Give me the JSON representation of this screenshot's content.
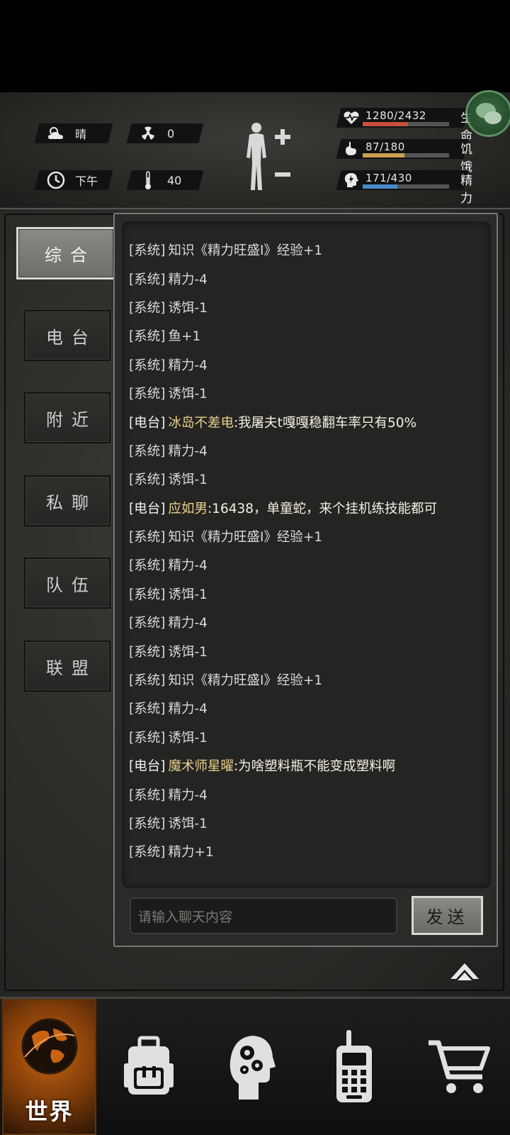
{
  "status": {
    "weather": {
      "icon": "cloud-sun-icon",
      "label": "晴"
    },
    "radiation": {
      "icon": "radiation-icon",
      "value": "0"
    },
    "time": {
      "icon": "clock-icon",
      "label": "下午"
    },
    "temperature": {
      "icon": "thermometer-icon",
      "value": "40"
    },
    "stats": [
      {
        "icon": "heart-pulse-icon",
        "text": "1280/2432",
        "label": "生命",
        "current": 1280,
        "max": 2432,
        "color": "#c9503a"
      },
      {
        "icon": "stomach-icon",
        "text": "87/180",
        "label": "饥饿",
        "current": 87,
        "max": 180,
        "color": "#c9a050"
      },
      {
        "icon": "head-lightning-icon",
        "text": "171/430",
        "label": "精力",
        "current": 171,
        "max": 430,
        "color": "#4a8ac9"
      }
    ]
  },
  "tabs": [
    {
      "label": "综合",
      "active": true
    },
    {
      "label": "电台",
      "active": false
    },
    {
      "label": "附近",
      "active": false
    },
    {
      "label": "私聊",
      "active": false
    },
    {
      "label": "队伍",
      "active": false
    },
    {
      "label": "联盟",
      "active": false
    }
  ],
  "chat": {
    "messages": [
      {
        "type": "system",
        "tag": "[系统]",
        "text": "知识《精力旺盛Ⅰ》经验+1"
      },
      {
        "type": "system",
        "tag": "[系统]",
        "text": "精力-4"
      },
      {
        "type": "system",
        "tag": "[系统]",
        "text": "诱饵-1"
      },
      {
        "type": "system",
        "tag": "[系统]",
        "text": "鱼+1"
      },
      {
        "type": "system",
        "tag": "[系统]",
        "text": "精力-4"
      },
      {
        "type": "system",
        "tag": "[系统]",
        "text": "诱饵-1"
      },
      {
        "type": "radio",
        "tag": "[电台]",
        "name": "冰岛不差电",
        "text": ":我屠夫t嘎嘎稳翻车率只有50%"
      },
      {
        "type": "system",
        "tag": "[系统]",
        "text": "精力-4"
      },
      {
        "type": "system",
        "tag": "[系统]",
        "text": "诱饵-1"
      },
      {
        "type": "radio",
        "tag": "[电台]",
        "name": "应如男",
        "text": ":16438，单童蛇，来个挂机练技能都可"
      },
      {
        "type": "system",
        "tag": "[系统]",
        "text": "知识《精力旺盛Ⅰ》经验+1"
      },
      {
        "type": "system",
        "tag": "[系统]",
        "text": "精力-4"
      },
      {
        "type": "system",
        "tag": "[系统]",
        "text": "诱饵-1"
      },
      {
        "type": "system",
        "tag": "[系统]",
        "text": "精力-4"
      },
      {
        "type": "system",
        "tag": "[系统]",
        "text": "诱饵-1"
      },
      {
        "type": "system",
        "tag": "[系统]",
        "text": "知识《精力旺盛Ⅰ》经验+1"
      },
      {
        "type": "system",
        "tag": "[系统]",
        "text": "精力-4"
      },
      {
        "type": "system",
        "tag": "[系统]",
        "text": "诱饵-1"
      },
      {
        "type": "radio",
        "tag": "[电台]",
        "name": "魔术师星曜",
        "text": ":为啥塑料瓶不能变成塑料啊"
      },
      {
        "type": "system",
        "tag": "[系统]",
        "text": "精力-4"
      },
      {
        "type": "system",
        "tag": "[系统]",
        "text": "诱饵-1"
      },
      {
        "type": "system",
        "tag": "[系统]",
        "text": "精力+1"
      }
    ],
    "input_placeholder": "请输入聊天内容",
    "send_label": "发送"
  },
  "bottom_nav": [
    {
      "label": "世界",
      "icon": "globe-icon",
      "active": true
    },
    {
      "label": "",
      "icon": "backpack-icon",
      "active": false
    },
    {
      "label": "",
      "icon": "head-gears-icon",
      "active": false
    },
    {
      "label": "",
      "icon": "walkie-talkie-icon",
      "active": false
    },
    {
      "label": "",
      "icon": "shopping-cart-icon",
      "active": false
    }
  ]
}
